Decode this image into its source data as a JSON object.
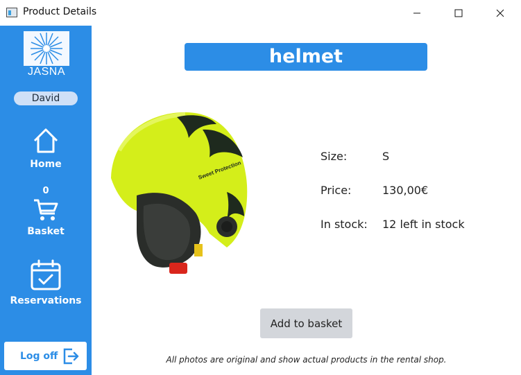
{
  "window": {
    "title": "Product Details"
  },
  "sidebar": {
    "logo_text": "JASNA",
    "user_name": "David",
    "nav": [
      {
        "label": "Home",
        "icon": "home-icon"
      },
      {
        "label": "Basket",
        "icon": "cart-icon",
        "badge": "0"
      },
      {
        "label": "Reservations",
        "icon": "calendar-check-icon"
      }
    ],
    "logoff_label": "Log off"
  },
  "product": {
    "name": "helmet",
    "details": [
      {
        "key": "Size:",
        "value": "S"
      },
      {
        "key": "Price:",
        "value": "130,00€"
      },
      {
        "key": "In stock:",
        "value": "12 left in stock"
      }
    ],
    "image": {
      "description": "yellow ski helmet",
      "brand_text": "Sweet Protection"
    }
  },
  "actions": {
    "add_to_basket": "Add to basket"
  },
  "footnote": "All photos are original and show actual products in the rental shop.",
  "colors": {
    "accent": "#2c8de6",
    "button_grey": "#d3d6db",
    "helmet_yellow": "#d4ee1a"
  }
}
